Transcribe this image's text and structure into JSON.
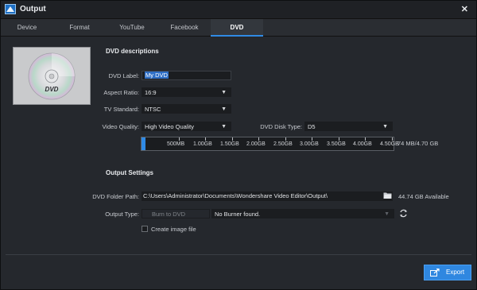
{
  "window": {
    "title": "Output",
    "close_label": "✕"
  },
  "tabs": [
    {
      "label": "Device"
    },
    {
      "label": "Format"
    },
    {
      "label": "YouTube"
    },
    {
      "label": "Facebook"
    },
    {
      "label": "DVD",
      "active": true
    }
  ],
  "dvd": {
    "section_title": "DVD descriptions",
    "thumbnail_text": "DVD",
    "label_label": "DVD Label:",
    "label_value": "My DVD",
    "aspect_label": "Aspect Ratio:",
    "aspect_value": "16:9",
    "tv_label": "TV Standard:",
    "tv_value": "NTSC",
    "quality_label": "Video Quality:",
    "quality_value": "High Video Quality",
    "disk_type_label": "DVD Disk Type:",
    "disk_type_value": "D5",
    "capacity": {
      "used_fraction": 0.0156,
      "info": "74 MB/4.70 GB",
      "ticks": [
        "500MB",
        "1.00GB",
        "1.50GB",
        "2.00GB",
        "2.50GB",
        "3.00GB",
        "3.50GB",
        "4.00GB",
        "4.50GB"
      ]
    }
  },
  "output": {
    "section_title": "Output Settings",
    "folder_label": "DVD Folder Path:",
    "folder_value": "C:\\Users\\Administrator\\Documents\\Wondershare Video Editor\\Output\\",
    "available": "44.74 GB Available",
    "type_label": "Output Type:",
    "type_value": "Burn to DVD",
    "burner_value": "No Burner found.",
    "image_file_label": "Create image file",
    "image_file_checked": false
  },
  "export_label": "Export",
  "colors": {
    "accent": "#2f8ae5",
    "background": "#25282d"
  }
}
